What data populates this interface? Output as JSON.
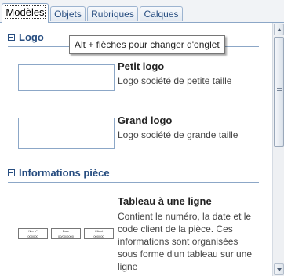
{
  "tabs": [
    {
      "label": "Modèles",
      "active": true
    },
    {
      "label": "Objets",
      "active": false
    },
    {
      "label": "Rubriques",
      "active": false
    },
    {
      "label": "Calques",
      "active": false
    }
  ],
  "tooltip": "Alt + flèches pour changer d'onglet",
  "sections": {
    "logo": {
      "title": "Logo",
      "items": [
        {
          "title": "Petit logo",
          "desc": "Logo société de petite taille"
        },
        {
          "title": "Grand logo",
          "desc": "Logo société de grande taille"
        }
      ]
    },
    "infos": {
      "title": "Informations pièce",
      "items": [
        {
          "title": "Tableau à une ligne",
          "desc": "Contient le numéro, la date et le code client de la pièce. Ces informations sont organisées sous forme d'un tableau sur une ligne",
          "thumb": {
            "headers": [
              "N.o n°",
              "Date",
              "Client"
            ],
            "values": [
              "000000",
              "00/00/0000",
              "000000"
            ]
          }
        }
      ]
    }
  },
  "colors": {
    "accent": "#274d80",
    "border": "#8ca7c7"
  }
}
